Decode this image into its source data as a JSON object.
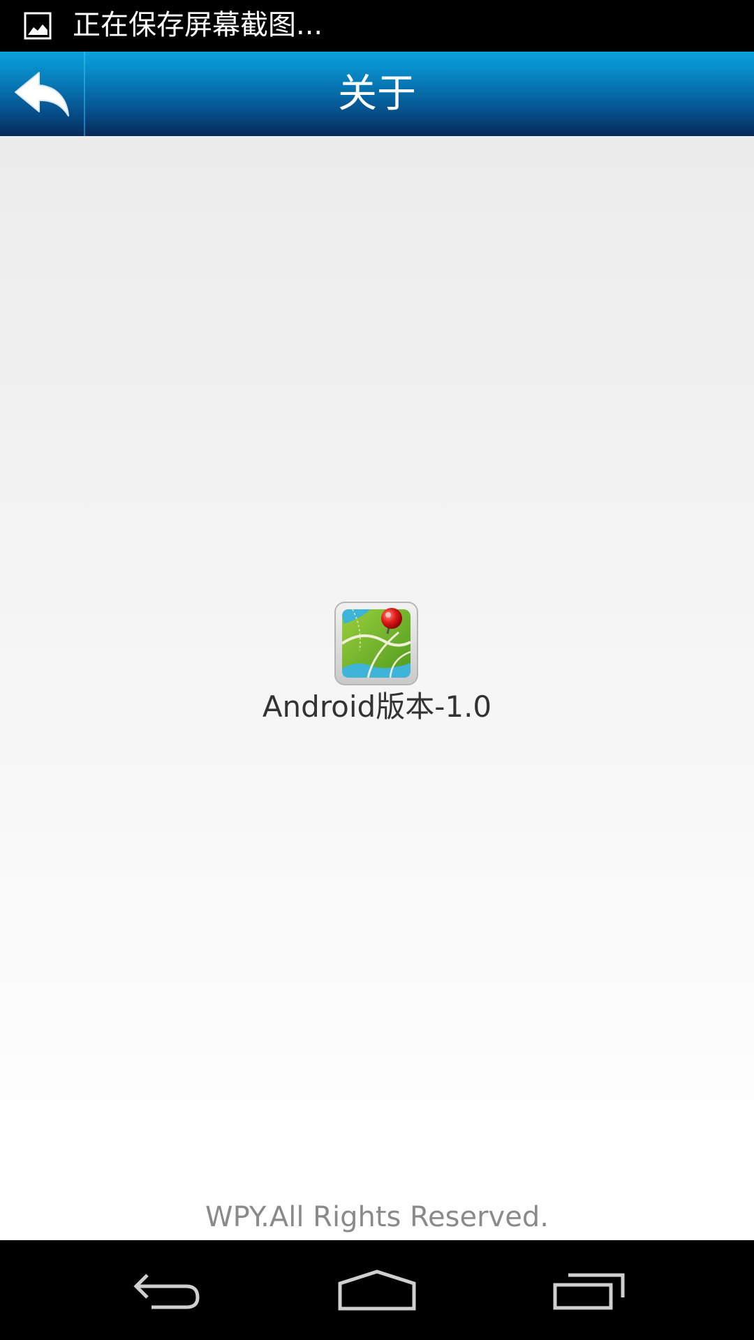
{
  "status_bar": {
    "notification_icon": "image-icon",
    "text": "正在保存屏幕截图..."
  },
  "title_bar": {
    "back_icon": "back-arrow-icon",
    "title": "关于"
  },
  "content": {
    "app_icon": "map-pin-app-icon",
    "version": "Android版本-1.0",
    "copyright": "WPY.All Rights Reserved."
  },
  "nav_bar": {
    "back_icon": "nav-back-icon",
    "home_icon": "nav-home-icon",
    "recents_icon": "nav-recents-icon"
  },
  "colors": {
    "title_bar_top": "#0aa2de",
    "title_bar_bottom": "#062a56",
    "background": "#f4f4f4"
  }
}
